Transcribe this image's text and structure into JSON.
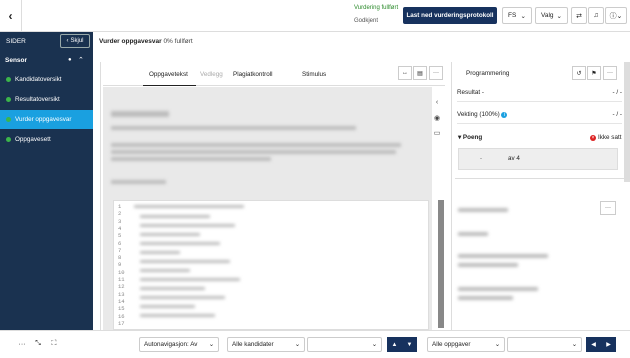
{
  "topbar": {
    "back_icon": "chevron-left-icon",
    "status_success": "Vurdering fullført",
    "status_approved": "Godkjent",
    "download_button": "Last ned vurderingsprotokoll",
    "user_initials": "FS",
    "valg_label": "Valg"
  },
  "sidebar": {
    "title": "SIDER",
    "hide_button": "Skjul",
    "section": "Sensor",
    "items": [
      {
        "label": "Kandidatoversikt",
        "status_color": "#3cb54a"
      },
      {
        "label": "Resultatoversikt",
        "status_color": "#3cb54a"
      },
      {
        "label": "Vurder oppgavesvar",
        "status_color": "#3cb54a",
        "active": true
      },
      {
        "label": "Oppgavesett",
        "status_color": "#3cb54a"
      }
    ]
  },
  "main": {
    "title": "Vurder oppgavesvar",
    "progress": "0% fullført",
    "tabs": [
      "Oppgavetekst",
      "Vedlegg",
      "Plagiatkontroll",
      "Stimulus"
    ],
    "line_numbers": [
      "1",
      "2",
      "3",
      "4",
      "5",
      "6",
      "7",
      "8",
      "9",
      "10",
      "11",
      "12",
      "13",
      "14",
      "15",
      "16",
      "17"
    ]
  },
  "right_panel": {
    "question_type": "Programmering",
    "result_label": "Resultat -",
    "result_value": "- / -",
    "weight_label": "Vekting (100%)",
    "weight_value": "- / -",
    "points_label": "Poeng",
    "not_set": "Ikke satt",
    "score_placeholder": "-",
    "score_max": "av 4"
  },
  "bottombar": {
    "autonav": "Autonavigasjon: Av",
    "candidates": "Alle kandidater",
    "tasks": "Alle oppgaver"
  },
  "colors": {
    "sidebar_bg": "#1a3250",
    "active_item": "#1aa0e0",
    "primary_button": "#17325e",
    "success": "#2a8a2a",
    "error": "#d22222"
  }
}
